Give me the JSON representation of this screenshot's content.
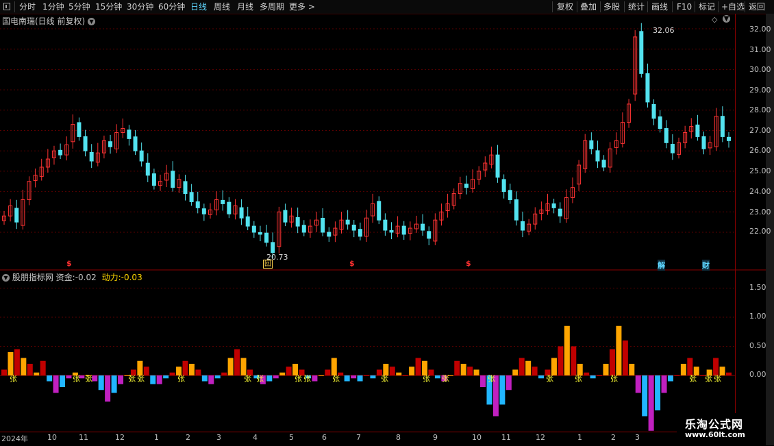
{
  "toolbar": {
    "periods": [
      "分时",
      "1分钟",
      "5分钟",
      "15分钟",
      "30分钟",
      "60分钟",
      "日线",
      "周线",
      "月线",
      "多周期",
      "更多 >"
    ],
    "active_period": "日线",
    "right_buttons": [
      "复权",
      "叠加",
      "多股",
      "统计",
      "画线",
      "F10",
      "标记",
      "+自选",
      "返回"
    ]
  },
  "main_panel": {
    "title": "国电南瑞(日线 前复权)",
    "high_label": "32.06",
    "low_label": "20.73",
    "price_ticks": [
      "32.00",
      "31.00",
      "30.00",
      "29.00",
      "28.00",
      "27.00",
      "26.00",
      "25.00",
      "24.00",
      "23.00",
      "22.00"
    ],
    "markers": [
      {
        "text": "$",
        "color": "#ff3030"
      },
      {
        "text": "回",
        "color": "#ffd24d"
      },
      {
        "text": "$",
        "color": "#ff3030"
      },
      {
        "text": "$",
        "color": "#ff3030"
      },
      {
        "text": "解",
        "color": "#5fd7ff"
      },
      {
        "text": "财",
        "color": "#5fd7ff"
      }
    ]
  },
  "indicator_panel": {
    "name": "股朋指标网",
    "fund_label": "资金:",
    "fund_value": "-0.02",
    "momentum_label": "动力:",
    "momentum_value": "-0.03",
    "ticks": [
      "1.50",
      "1.00",
      "0.50",
      "0.00"
    ],
    "signal_glyph": "张"
  },
  "date_axis": [
    "2024年",
    "10",
    "11",
    "12",
    "1",
    "2",
    "3",
    "4",
    "5",
    "6",
    "7",
    "8",
    "9",
    "10",
    "11",
    "12",
    "1",
    "2",
    "3"
  ],
  "watermark": {
    "line1": "乐淘公式网",
    "line2": "www.60lt.com"
  },
  "colors": {
    "up": "#ff3333",
    "down": "#53e3ef",
    "grid": "#5a0000",
    "axis": "#8b0000",
    "fund_up": "#ffa500",
    "fund_up_dark": "#c00000",
    "fund_down": "#21b6ff",
    "fund_down_m": "#c020c0",
    "ma_yellow": "#ffff33"
  },
  "chart_data": {
    "type": "candlestick",
    "series": [
      {
        "name": "close",
        "values": [
          22.8,
          23.3,
          22.5,
          23.6,
          24.5,
          24.8,
          25.2,
          25.6,
          26.0,
          25.8,
          26.3,
          27.3,
          26.7,
          26.0,
          25.5,
          25.9,
          26.5,
          26.2,
          26.9,
          27.1,
          26.6,
          26.0,
          25.5,
          24.8,
          24.3,
          24.5,
          24.9,
          24.2,
          24.6,
          23.9,
          23.5,
          23.2,
          22.9,
          23.1,
          23.6,
          23.4,
          22.9,
          23.3,
          22.7,
          22.3,
          22.0,
          21.9,
          21.5,
          21.0,
          23.0,
          22.5,
          22.8,
          22.3,
          22.0,
          22.3,
          22.6,
          22.0,
          21.8,
          22.2,
          22.6,
          22.4,
          22.1,
          21.8,
          22.7,
          23.4,
          22.6,
          22.1,
          22.0,
          22.3,
          21.9,
          22.2,
          22.4,
          22.1,
          21.7,
          22.6,
          23.0,
          23.4,
          23.9,
          24.4,
          24.2,
          24.6,
          25.0,
          25.4,
          25.8,
          24.7,
          24.0,
          23.6,
          22.6,
          22.1,
          22.4,
          22.9,
          23.1,
          23.4,
          23.2,
          22.8,
          23.7,
          24.2,
          25.3,
          26.5,
          26.1,
          25.5,
          25.2,
          26.1,
          26.5,
          27.4,
          28.3,
          31.6,
          29.8,
          28.4,
          27.6,
          27.1,
          26.4,
          25.9,
          26.4,
          26.9,
          27.2,
          26.7,
          26.1,
          26.4,
          27.7,
          26.7,
          26.5
        ]
      },
      {
        "name": "资金",
        "values": [
          0.1,
          0.4,
          0.45,
          0.3,
          0.2,
          0.05,
          0.25,
          -0.1,
          -0.3,
          -0.2,
          -0.05,
          0.05,
          -0.05,
          0.0,
          -0.1,
          -0.25,
          -0.45,
          -0.3,
          -0.15,
          0.0,
          0.1,
          0.25,
          0.15,
          -0.15,
          -0.15,
          -0.05,
          0.05,
          0.15,
          0.25,
          0.2,
          0.1,
          -0.1,
          -0.15,
          -0.05,
          0.05,
          0.3,
          0.45,
          0.3,
          0.1,
          -0.05,
          -0.15,
          -0.1,
          -0.05,
          0.05,
          0.15,
          0.2,
          0.1,
          -0.05,
          -0.1,
          0.0,
          0.1,
          0.3,
          0.05,
          -0.1,
          -0.05,
          -0.1,
          0.0,
          -0.05,
          0.1,
          0.2,
          0.15,
          0.05,
          0.0,
          0.15,
          0.3,
          0.25,
          0.1,
          -0.05,
          -0.1,
          0.0,
          0.25,
          0.2,
          0.15,
          0.1,
          -0.2,
          -0.5,
          -0.7,
          -0.5,
          -0.25,
          0.1,
          0.3,
          0.25,
          0.15,
          -0.05,
          0.1,
          0.3,
          0.5,
          0.85,
          0.5,
          0.2,
          0.05,
          -0.05,
          0.0,
          0.2,
          0.45,
          0.85,
          0.6,
          0.2,
          -0.3,
          -0.7,
          -0.95,
          -0.6,
          -0.3,
          -0.1,
          0.0,
          0.2,
          0.3,
          0.15,
          0.0,
          0.1,
          0.3,
          0.15,
          0.05
        ]
      }
    ]
  }
}
